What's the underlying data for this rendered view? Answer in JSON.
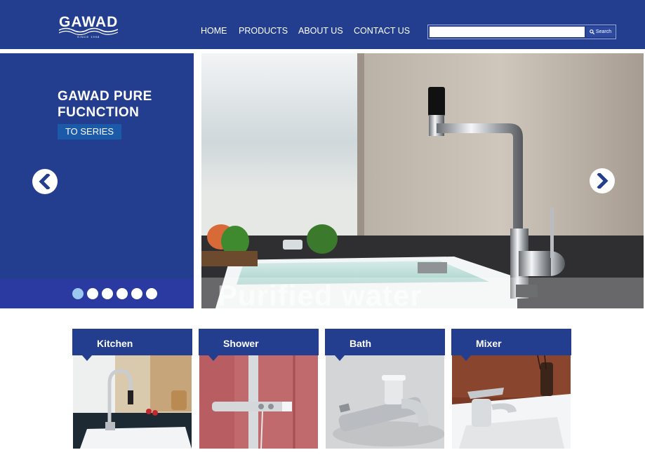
{
  "brand": {
    "name": "GAWAD",
    "tagline": "SINCE 1998"
  },
  "nav": {
    "items": [
      "HOME",
      "PRODUCTS",
      "ABOUT US",
      "CONTACT US"
    ]
  },
  "search": {
    "value": "",
    "button_label": "Search"
  },
  "hero": {
    "title": "GAWAD PURE FUCNCTION",
    "button_label": "TO SERIES",
    "overlay_text": "Purified water",
    "slide_count": 6,
    "active_slide": 1
  },
  "categories": [
    {
      "label": "Kitchen"
    },
    {
      "label": "Shower"
    },
    {
      "label": "Bath"
    },
    {
      "label": "Mixer"
    }
  ],
  "colors": {
    "primary": "#233e8e",
    "accent_button": "#1a5aa8",
    "active_dot": "#9cc8f0"
  }
}
